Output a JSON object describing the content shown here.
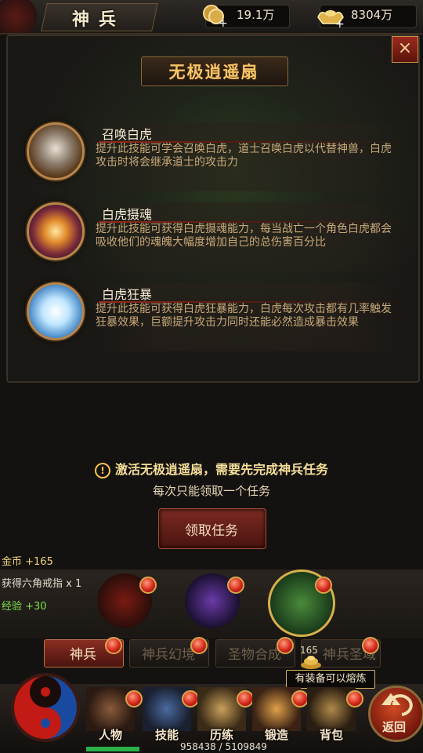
{
  "header": {
    "title": "神兵",
    "gold": "19.1万",
    "ingot": "8304万"
  },
  "panel": {
    "weapon_name": "无极逍遥扇",
    "close_label": "×",
    "skills": [
      {
        "name": "召唤白虎",
        "desc": "提升此技能可学会召唤白虎，道士召唤白虎以代替神兽，白虎攻击时将会继承道士的攻击力",
        "icon": "white-tiger-icon"
      },
      {
        "name": "白虎摄魂",
        "desc": "提升此技能可获得白虎摄魂能力，每当战亡一个角色白虎都会吸收他们的魂魄大幅度增加自己的总伤害百分比",
        "icon": "soul-vortex-icon"
      },
      {
        "name": "白虎狂暴",
        "desc": "提升此技能可获得白虎狂暴能力，白虎每次攻击都有几率触发狂暴效果，巨额提升攻击力同时还能必然造成暴击效果",
        "icon": "claw-icon"
      }
    ]
  },
  "notice": {
    "main": "激活无极逍遥扇，需要先完成神兵任务",
    "sub": "每次只能领取一个任务",
    "claim_button": "领取任务"
  },
  "log": {
    "gold": "金币  +165",
    "item": "获得六角戒指 x 1",
    "exp": "经验 +30"
  },
  "weapons": [
    "scythe-weapon-icon",
    "purple-sword-icon",
    "green-fan-icon"
  ],
  "tabs": [
    {
      "label": "神兵"
    },
    {
      "label": "神兵幻境"
    },
    {
      "label": "圣物合成"
    },
    {
      "label": "神兵圣域"
    }
  ],
  "tab4_prefix": "165",
  "tooltip": "有装备可以熔炼",
  "bottom_menu": [
    {
      "label": "人物",
      "icon": "helmet-icon"
    },
    {
      "label": "技能",
      "icon": "skill-book-icon"
    },
    {
      "label": "历练",
      "icon": "armor-icon"
    },
    {
      "label": "锻造",
      "icon": "anvil-icon"
    },
    {
      "label": "背包",
      "icon": "bag-icon"
    }
  ],
  "return_label": "返回",
  "experience": {
    "text": "958438 / 5109849",
    "fraction": 0.1876
  },
  "colors": {
    "accent_gold": "#f3c66a",
    "notice_yellow": "#f6df9a",
    "exp_green": "#7ee04a",
    "red_badge": "#d4281c"
  }
}
